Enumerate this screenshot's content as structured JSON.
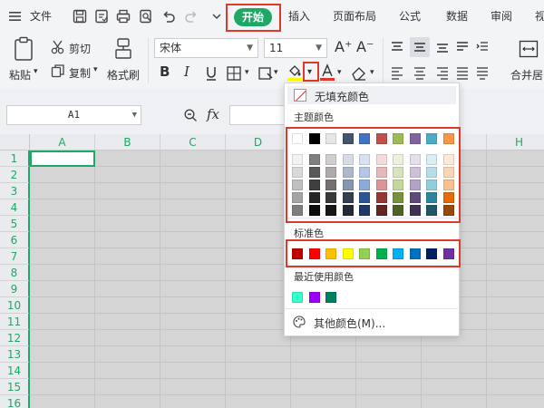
{
  "menubar": {
    "file_label": "文件",
    "tabs": [
      {
        "label": "开始",
        "active": true
      },
      {
        "label": "插入"
      },
      {
        "label": "页面布局"
      },
      {
        "label": "公式"
      },
      {
        "label": "数据"
      },
      {
        "label": "审阅"
      },
      {
        "label": "视"
      }
    ]
  },
  "ribbon": {
    "paste_label": "粘贴",
    "cut_label": "剪切",
    "copy_label": "复制",
    "format_painter_label": "格式刷",
    "font_name": "宋体",
    "font_size": "11",
    "bold": "B",
    "italic": "I",
    "merge_center_label": "合并居"
  },
  "formula_bar": {
    "cell_ref": "A1",
    "fx": "fx"
  },
  "grid": {
    "columns": [
      "A",
      "B",
      "C",
      "D",
      "",
      "",
      "",
      "H"
    ],
    "rows": [
      "1",
      "2",
      "3",
      "4",
      "5",
      "6",
      "7",
      "8",
      "9",
      "10",
      "11",
      "12",
      "13",
      "14",
      "15",
      "16"
    ]
  },
  "fill_dropdown": {
    "no_fill_label": "无填充颜色",
    "theme_colors_label": "主题颜色",
    "standard_colors_label": "标准色",
    "recent_colors_label": "最近使用颜色",
    "more_colors_label": "其他颜色(M)...",
    "theme_top_row": [
      "#ffffff",
      "#000000",
      "#e7e6e6",
      "#44546a",
      "#4472c4",
      "#c0504d",
      "#9bbb59",
      "#8064a2",
      "#4bacc6",
      "#f79646"
    ],
    "theme_shades": [
      [
        "#f2f2f2",
        "#7f7f7f",
        "#d0cece",
        "#d6dce4",
        "#d9e2f3",
        "#f2dcdb",
        "#ebf1dd",
        "#e5e0ec",
        "#dbeef3",
        "#fde9d9"
      ],
      [
        "#d8d8d8",
        "#595959",
        "#aeaaaa",
        "#adb9ca",
        "#b4c6e7",
        "#e5b9b7",
        "#d7e3bc",
        "#ccc1d9",
        "#b7dde8",
        "#fbd5b5"
      ],
      [
        "#bfbfbf",
        "#3f3f3f",
        "#757070",
        "#8496b0",
        "#8eaadb",
        "#d99694",
        "#c3d69b",
        "#b2a2c7",
        "#92cddc",
        "#fac08f"
      ],
      [
        "#a5a5a5",
        "#262626",
        "#3a3838",
        "#333f50",
        "#2f5496",
        "#953734",
        "#76923c",
        "#5f497a",
        "#31859b",
        "#e36c09"
      ],
      [
        "#7f7f7f",
        "#0c0c0c",
        "#171616",
        "#222a35",
        "#1f3864",
        "#632423",
        "#4f6128",
        "#3f3151",
        "#205867",
        "#974806"
      ]
    ],
    "standard_colors": [
      "#c00000",
      "#ff0000",
      "#ffc000",
      "#ffff00",
      "#92d050",
      "#00b050",
      "#00b0f0",
      "#0070c0",
      "#002060",
      "#7030a0"
    ],
    "recent_colors": [
      "#33ffcc",
      "#9900ff",
      "#008060"
    ]
  },
  "icons": {
    "menu": "hamburger-icon",
    "save": "save-icon",
    "print": "print-icon",
    "undo": "undo-icon",
    "redo": "redo-icon",
    "fill_color": "fill-bucket-icon",
    "more_colors": "palette-icon"
  },
  "colors": {
    "accent": "#1fa865",
    "highlight_box": "#e0392b"
  }
}
